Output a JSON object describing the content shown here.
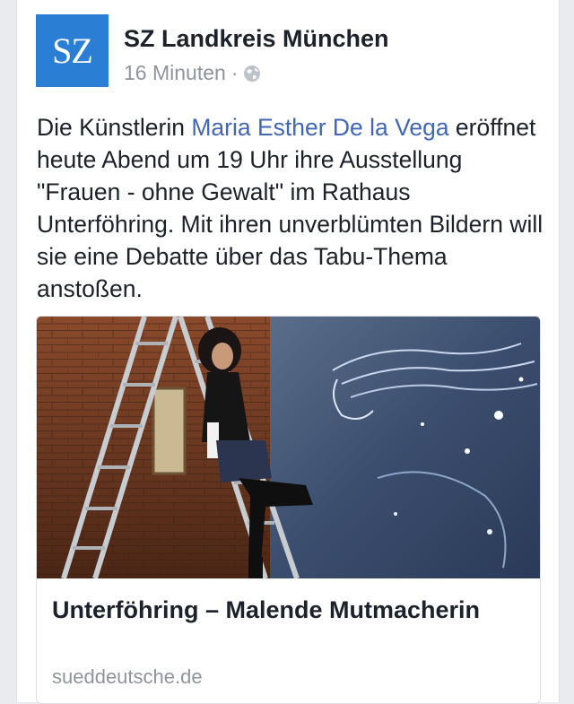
{
  "post": {
    "avatar_text": "SZ",
    "page_name": "SZ Landkreis München",
    "timestamp": "16 Minuten",
    "separator": "·",
    "privacy_icon": "globe-icon",
    "text_before_mention": "Die Künstlerin ",
    "mention": "Maria Esther De la Vega",
    "text_after_mention": " eröffnet heute Abend um 19 Uhr ihre Ausstellung \"Frauen - ohne Gewalt\" im Rathaus Unterföhring. Mit ihren unverblümten Bildern will sie eine Debatte über das Tabu-Thema anstoßen."
  },
  "link_preview": {
    "title": "Unterföhring – Malende Mutmacherin",
    "domain": "sueddeutsche.de"
  },
  "colors": {
    "brand_blue": "#2a7fd4",
    "mention_blue": "#4267b2",
    "text": "#1d2129",
    "muted": "#90949c"
  }
}
